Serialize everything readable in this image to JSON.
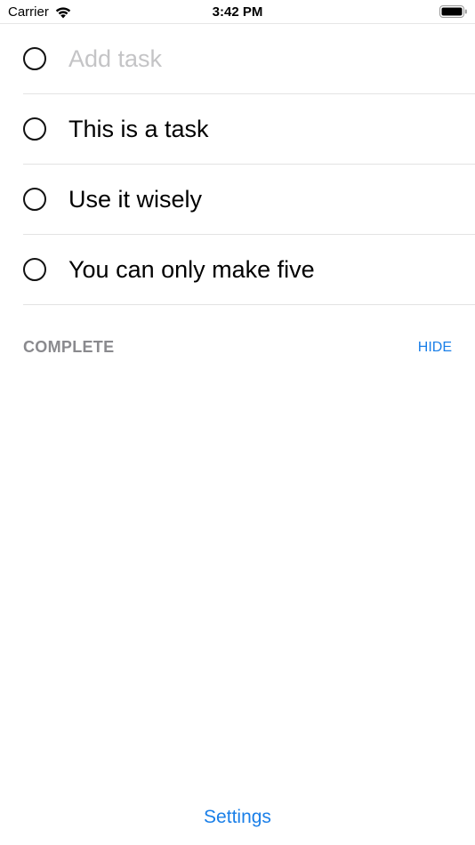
{
  "status_bar": {
    "carrier": "Carrier",
    "time": "3:42 PM",
    "icons": [
      "wifi-icon",
      "battery-icon"
    ]
  },
  "tasks": {
    "add_placeholder": "Add task",
    "items": [
      {
        "label": "This is a task",
        "completed": false
      },
      {
        "label": "Use it wisely",
        "completed": false
      },
      {
        "label": "You can only make five",
        "completed": false
      }
    ]
  },
  "complete_section": {
    "title": "COMPLETE",
    "hide_label": "HIDE"
  },
  "footer": {
    "settings_label": "Settings"
  },
  "colors": {
    "accent": "#1a7fe8",
    "section_title": "#8a8a8e",
    "placeholder": "#c4c4c6",
    "separator": "#e3e3e3"
  }
}
